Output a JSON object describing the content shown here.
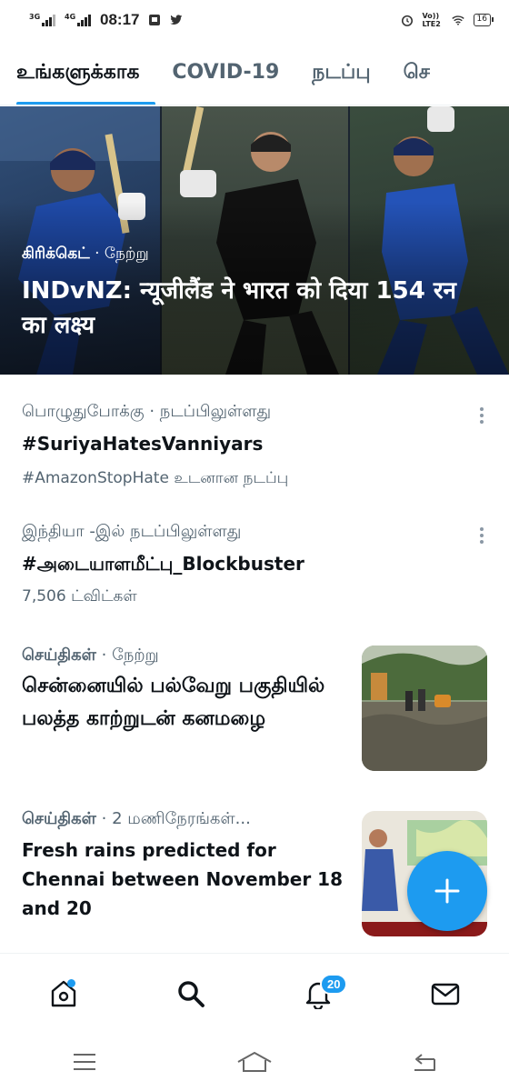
{
  "status_bar": {
    "network1": "3G",
    "network2": "4G",
    "time": "08:17",
    "volte": "Vo)) LTE2",
    "battery": "16"
  },
  "tabs": [
    {
      "label": "உங்களுக்காக",
      "active": true
    },
    {
      "label": "COVID-19",
      "active": false
    },
    {
      "label": "நடப்பு",
      "active": false
    },
    {
      "label": "செ",
      "active": false
    }
  ],
  "hero": {
    "category": "கிரிக்கெட்",
    "separator": " · ",
    "time": "நேற்று",
    "title": "INDvNZ: न्यूजीलैंड ने भारत को दिया 154 रन का लक्ष्य"
  },
  "trends": [
    {
      "meta": "பொழுதுபோக்கு · நடப்பிலுள்ளது",
      "headline": "#SuriyaHatesVanniyars",
      "sub": "#AmazonStopHate உடனான நடப்பு"
    },
    {
      "meta": "இந்தியா -இல் நடப்பிலுள்ளது",
      "headline": "#அடையாளமீட்பு_Blockbuster",
      "sub": "7,506 ட்விட்கள்"
    }
  ],
  "news": [
    {
      "category": "செய்திகள்",
      "time": " · நேற்று",
      "headline": "சென்னையில் பல்வேறு பகுதியில் பலத்த காற்றுடன் கனமழை"
    },
    {
      "category": "செய்திகள்",
      "time": " · 2 மணிநேரங்கள்...",
      "headline": "Fresh rains predicted for Chennai between November 18 and 20"
    }
  ],
  "bottom_nav": {
    "notifications_badge": "20",
    "icons": [
      "home-icon",
      "search-icon",
      "notifications-icon",
      "messages-icon"
    ]
  },
  "colors": {
    "accent": "#1d9bf0",
    "text_primary": "#0f1419",
    "text_secondary": "#536471"
  }
}
